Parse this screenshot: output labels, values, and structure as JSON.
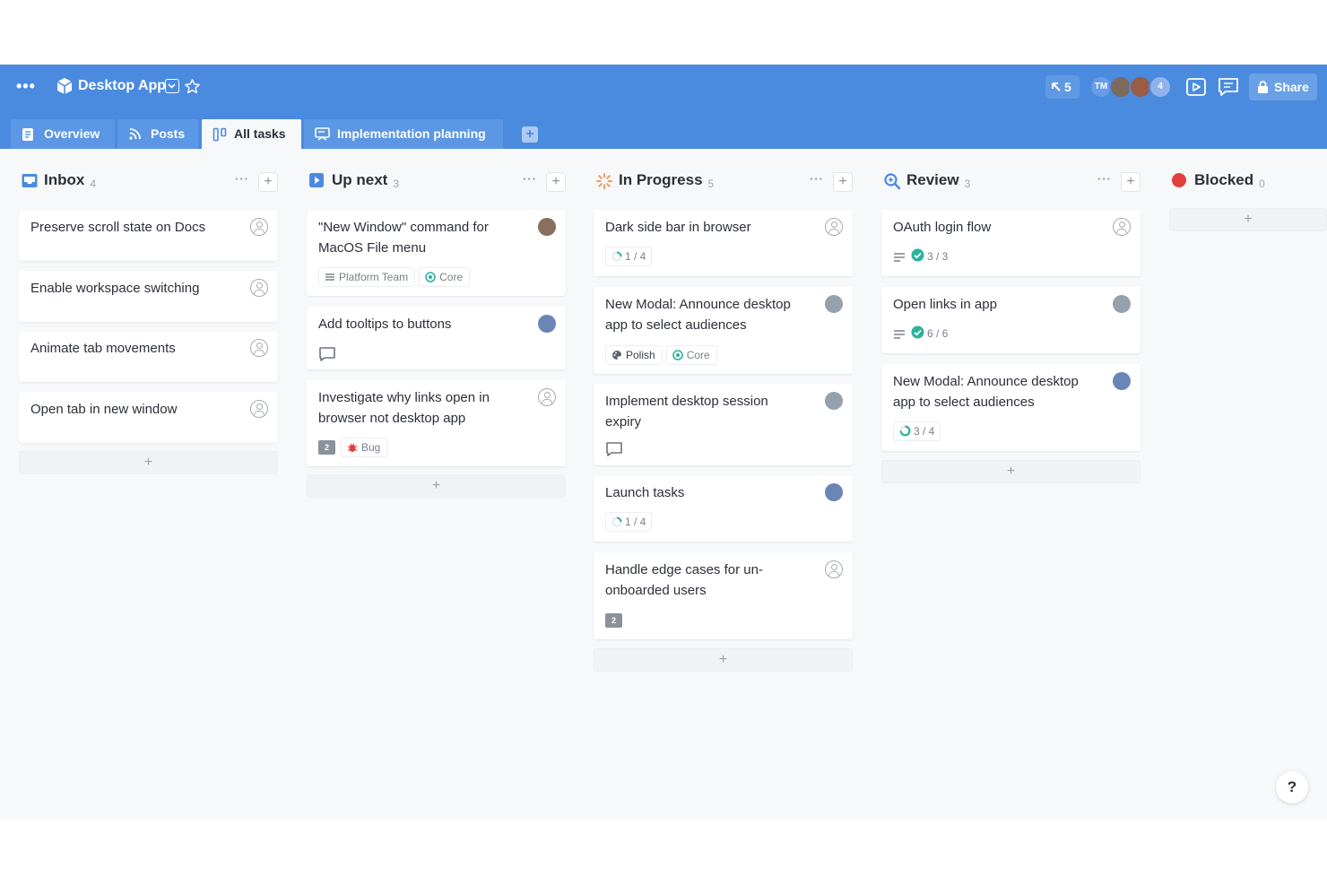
{
  "topbar": {
    "more_label": "•••",
    "app_title": "Desktop App",
    "cursor_count": "5",
    "avatars": [
      {
        "initials": "TM",
        "color": "#6a9be6"
      },
      {
        "initials": "",
        "color": "#7b6a5d"
      },
      {
        "initials": "",
        "color": "#9a5c45"
      },
      {
        "initials": "4",
        "color": "#8fb3ec"
      }
    ],
    "share_label": "Share"
  },
  "tabs": [
    {
      "label": "Overview",
      "icon": "doc-icon"
    },
    {
      "label": "Posts",
      "icon": "rss-icon"
    },
    {
      "label": "All tasks",
      "icon": "board-icon"
    },
    {
      "label": "Implementation planning",
      "icon": "presentation-icon"
    }
  ],
  "active_tab": "All tasks",
  "columns": [
    {
      "title": "Inbox",
      "count": "4",
      "icon": "inbox-icon",
      "color": "#4a8be0",
      "add_label": "+",
      "cards": [
        {
          "title": "Preserve scroll state on Docs"
        },
        {
          "title": "Enable workspace switching"
        },
        {
          "title": "Animate tab movements"
        },
        {
          "title": "Open tab in new window"
        }
      ]
    },
    {
      "title": "Up next",
      "count": "3",
      "icon": "play-square-icon",
      "color": "#4a8be0",
      "add_label": "+",
      "cards": [
        {
          "title": "\"New Window\" command for MacOS File menu",
          "tags": [
            "Platform Team",
            "Core"
          ]
        },
        {
          "title": "Add tooltips to buttons"
        },
        {
          "title": "Investigate why links open in browser not desktop app",
          "comment_count": "2",
          "tags": [
            "Bug"
          ]
        }
      ]
    },
    {
      "title": "In Progress",
      "count": "5",
      "icon": "spinner-icon",
      "color": "#f29a5c",
      "add_label": "+",
      "cards": [
        {
          "title": "Dark side bar in browser",
          "progress": "1 / 4"
        },
        {
          "title": "New Modal: Announce desktop app to select audiences",
          "tags": [
            "Polish",
            "Core"
          ]
        },
        {
          "title": "Implement desktop session expiry"
        },
        {
          "title": "Launch tasks",
          "progress": "1 / 4"
        },
        {
          "title": "Handle edge cases for un-onboarded users",
          "comment_count": "2"
        }
      ]
    },
    {
      "title": "Review",
      "count": "3",
      "icon": "magnifier-icon",
      "color": "#4a8be0",
      "add_label": "+",
      "cards": [
        {
          "title": "OAuth login flow",
          "progress": "3 / 3"
        },
        {
          "title": "Open links in app",
          "progress": "6 / 6"
        },
        {
          "title": "New Modal: Announce desktop app to select audiences",
          "progress": "3 / 4"
        }
      ]
    },
    {
      "title": "Blocked",
      "count": "0",
      "icon": "red-dot-icon",
      "color": "#e0413f",
      "add_label": "+",
      "cards": []
    }
  ],
  "help_label": "?"
}
